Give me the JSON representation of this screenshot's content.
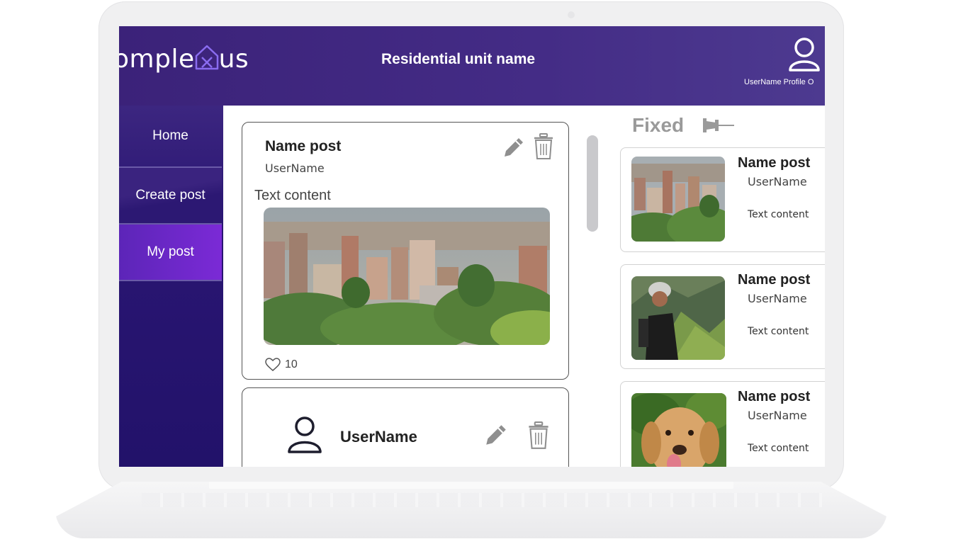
{
  "header": {
    "logo_left": "omple",
    "logo_mark": "x",
    "logo_right": "us",
    "title": "Residential unit name",
    "profile_label": "UserName Profile O"
  },
  "sidebar": {
    "items": [
      {
        "label": "Home"
      },
      {
        "label": "Create post"
      },
      {
        "label": "My post",
        "active": true
      }
    ]
  },
  "feed": {
    "post": {
      "title": "Name post",
      "user": "UserName",
      "text": "Text content",
      "likes": "10",
      "image": "city-skyline-photo"
    },
    "post2": {
      "user": "UserName"
    }
  },
  "fixed": {
    "header": "Fixed",
    "items": [
      {
        "title": "Name post",
        "user": "UserName",
        "text": "Text content",
        "image": "city-skyline-photo"
      },
      {
        "title": "Name post",
        "user": "UserName",
        "text": "Text content",
        "image": "hiker-mountains-photo"
      },
      {
        "title": "Name post",
        "user": "UserName",
        "text": "Text content",
        "image": "dog-photo"
      }
    ]
  },
  "colors": {
    "topbar": "#442c86",
    "sidebar": "#22126a",
    "active_nav": "#7b2ad6",
    "fixed_header": "#9a9a9a"
  }
}
